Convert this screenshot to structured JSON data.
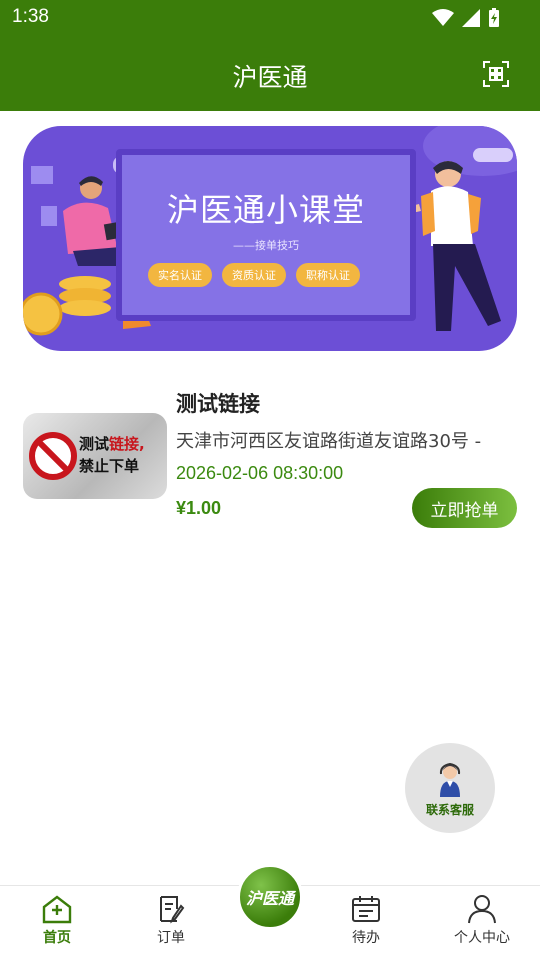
{
  "status_bar": {
    "time": "1:38"
  },
  "app_bar": {
    "title": "沪医通",
    "scan_icon": "scan-icon"
  },
  "banner": {
    "title": "沪医通小课堂",
    "subtitle": "——接单技巧",
    "tags": [
      "实名认证",
      "资质认证",
      "职称认证"
    ]
  },
  "orders": [
    {
      "title": "测试链接",
      "address": "天津市河西区友谊路街道友谊路30号 -",
      "time": "2026-02-06 08:30:00",
      "price": "¥1.00",
      "button": "立即抢单",
      "thumb": {
        "line1_a": "测试",
        "line1_b": "链接,",
        "line2": "禁止下单"
      }
    }
  ],
  "service": {
    "label": "联系客服"
  },
  "bottom_nav": {
    "items": [
      {
        "label": "首页",
        "icon": "home-icon",
        "active": true
      },
      {
        "label": "订单",
        "icon": "order-icon",
        "active": false
      },
      {
        "label": "待办",
        "icon": "calendar-icon",
        "active": false
      },
      {
        "label": "个人中心",
        "icon": "user-icon",
        "active": false
      }
    ],
    "center_logo": "沪医通"
  },
  "colors": {
    "primary": "#3b7d0a",
    "accent_green": "#3b8a10",
    "banner_purple": "#6c4fd6"
  }
}
